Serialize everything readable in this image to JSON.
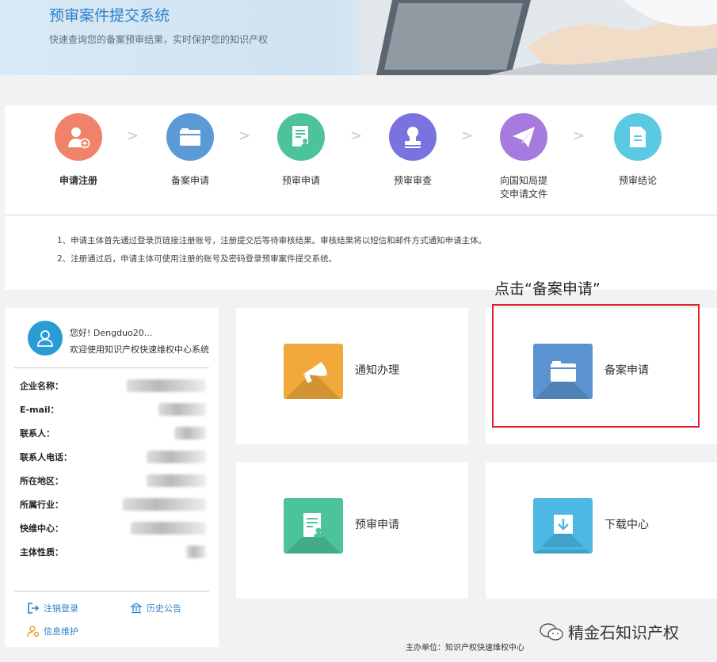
{
  "banner": {
    "title": "预审案件提交系统",
    "subtitle": "快速查询您的备案预审结果，实时保护您的知识产权"
  },
  "steps": [
    {
      "label": "申请注册",
      "color": "#f0826a",
      "icon": "user-add-icon",
      "active": true
    },
    {
      "label": "备案申请",
      "color": "#5b9ad6",
      "icon": "folder-icon"
    },
    {
      "label": "预审申请",
      "color": "#4cc39a",
      "icon": "document-user-icon"
    },
    {
      "label": "预审审查",
      "color": "#7a72de",
      "icon": "stamp-icon"
    },
    {
      "label": "向国知局提交申请文件",
      "color": "#a77ae0",
      "icon": "paper-plane-icon"
    },
    {
      "label": "预审结论",
      "color": "#5bc9e2",
      "icon": "document-lines-icon"
    }
  ],
  "notes": [
    "1、申请主体首先通过登录页链接注册账号，注册提交后等待审核结果。审核结果将以短信和邮件方式通知申请主体。",
    "2、注册通过后，申请主体可使用注册的账号及密码登录预审案件提交系统。"
  ],
  "annotation": "点击“备案申请”",
  "user": {
    "greeting": "您好! Dengduo20...",
    "welcome": "欢迎使用知识产权快速维权中心系统",
    "fields": [
      {
        "label": "企业名称：",
        "w": 100
      },
      {
        "label": "E-mail：",
        "w": 60
      },
      {
        "label": "联系人：",
        "w": 40
      },
      {
        "label": "联系人电话：",
        "w": 75
      },
      {
        "label": "所在地区：",
        "w": 75
      },
      {
        "label": "所属行业：",
        "w": 105
      },
      {
        "label": "快维中心：",
        "w": 95
      },
      {
        "label": "主体性质：",
        "w": 25
      }
    ],
    "links": {
      "logout": "注销登录",
      "history": "历史公告",
      "profile": "信息维护"
    }
  },
  "tiles": [
    {
      "label": "通知办理",
      "color": "#f0a93a",
      "icon": "megaphone-icon"
    },
    {
      "label": "备案申请",
      "color": "#5b93d0",
      "icon": "folder-icon"
    },
    {
      "label": "预审申请",
      "color": "#4cc39a",
      "icon": "document-user-icon"
    },
    {
      "label": "下载中心",
      "color": "#4cb8e3",
      "icon": "download-icon"
    }
  ],
  "footer": {
    "sponsor": "主办单位：知识产权快速维权中心",
    "watermark": "精金石知识产权"
  }
}
